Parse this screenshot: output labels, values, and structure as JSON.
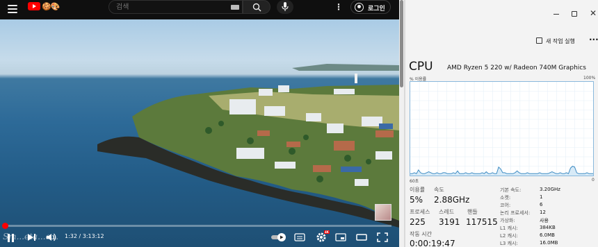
{
  "youtube": {
    "doodle_text": "🍪🎨",
    "search": {
      "placeholder": "검색",
      "value": ""
    },
    "login_label": "로그인",
    "player": {
      "current_time": "1:32",
      "duration": "3:13:12",
      "time_separator": " / ",
      "progress_fraction": 0.008,
      "watermark": "Sm...eta...o...",
      "hd_badge": "4K"
    }
  },
  "task_manager": {
    "run_task_label": "새 작업 실행",
    "cpu_title": "CPU",
    "cpu_model": "AMD Ryzen 5 220 w/ Radeon 740M Graphics",
    "util_label": "% 이용률",
    "util_max": "100%",
    "graph_left": "60초",
    "graph_right": "0",
    "stats": {
      "utilization_label": "이용률",
      "utilization_value": "5%",
      "speed_label": "속도",
      "speed_value": "2.88GHz",
      "processes_label": "프로세스",
      "processes_value": "225",
      "threads_label": "스레드",
      "threads_value": "3191",
      "handles_label": "핸들",
      "handles_value": "117515",
      "uptime_label": "작동 시간",
      "uptime_value": "0:00:19:47"
    },
    "specs": [
      {
        "key": "기본 속도:",
        "value": "3.20GHz"
      },
      {
        "key": "소켓:",
        "value": "1"
      },
      {
        "key": "코어:",
        "value": "6"
      },
      {
        "key": "논리 프로세서:",
        "value": "12"
      },
      {
        "key": "가상화:",
        "value": "사용"
      },
      {
        "key": "L1 캐시:",
        "value": "384KB"
      },
      {
        "key": "L2 캐시:",
        "value": "6.0MB"
      },
      {
        "key": "L3 캐시:",
        "value": "16.0MB"
      }
    ],
    "graph_series_percent": [
      2,
      2,
      3,
      2,
      6,
      3,
      2,
      2,
      3,
      4,
      3,
      2,
      2,
      3,
      2,
      2,
      3,
      3,
      2,
      2,
      2,
      3,
      2,
      5,
      2,
      2,
      2,
      3,
      2,
      2,
      3,
      2,
      2,
      2,
      2,
      3,
      2,
      4,
      2,
      2,
      3,
      2,
      2,
      9,
      7,
      3,
      3,
      2,
      2,
      2,
      2,
      3,
      5,
      3,
      2,
      2,
      2,
      3,
      2,
      2,
      2,
      2,
      2,
      3,
      2,
      2,
      2,
      2,
      3,
      4,
      3,
      2,
      2,
      3,
      2,
      2,
      3,
      2,
      8,
      10,
      9,
      3,
      2,
      2,
      2,
      2,
      3,
      2,
      2,
      2
    ],
    "colors": {
      "graph_line": "#3f8cc3",
      "graph_fill": "#d7eaf7",
      "graph_border": "#89b8dc"
    }
  },
  "icons": [
    "menu-icon",
    "youtube-logo",
    "search-icon",
    "keyboard-icon",
    "mic-icon",
    "more-vert-icon",
    "account-icon",
    "play-pause-icon",
    "next-icon",
    "volume-icon",
    "autoplay-toggle",
    "captions-icon",
    "settings-gear-icon",
    "miniplayer-icon",
    "theater-icon",
    "fullscreen-icon",
    "minimize-icon",
    "maximize-icon",
    "close-icon",
    "run-task-icon"
  ]
}
